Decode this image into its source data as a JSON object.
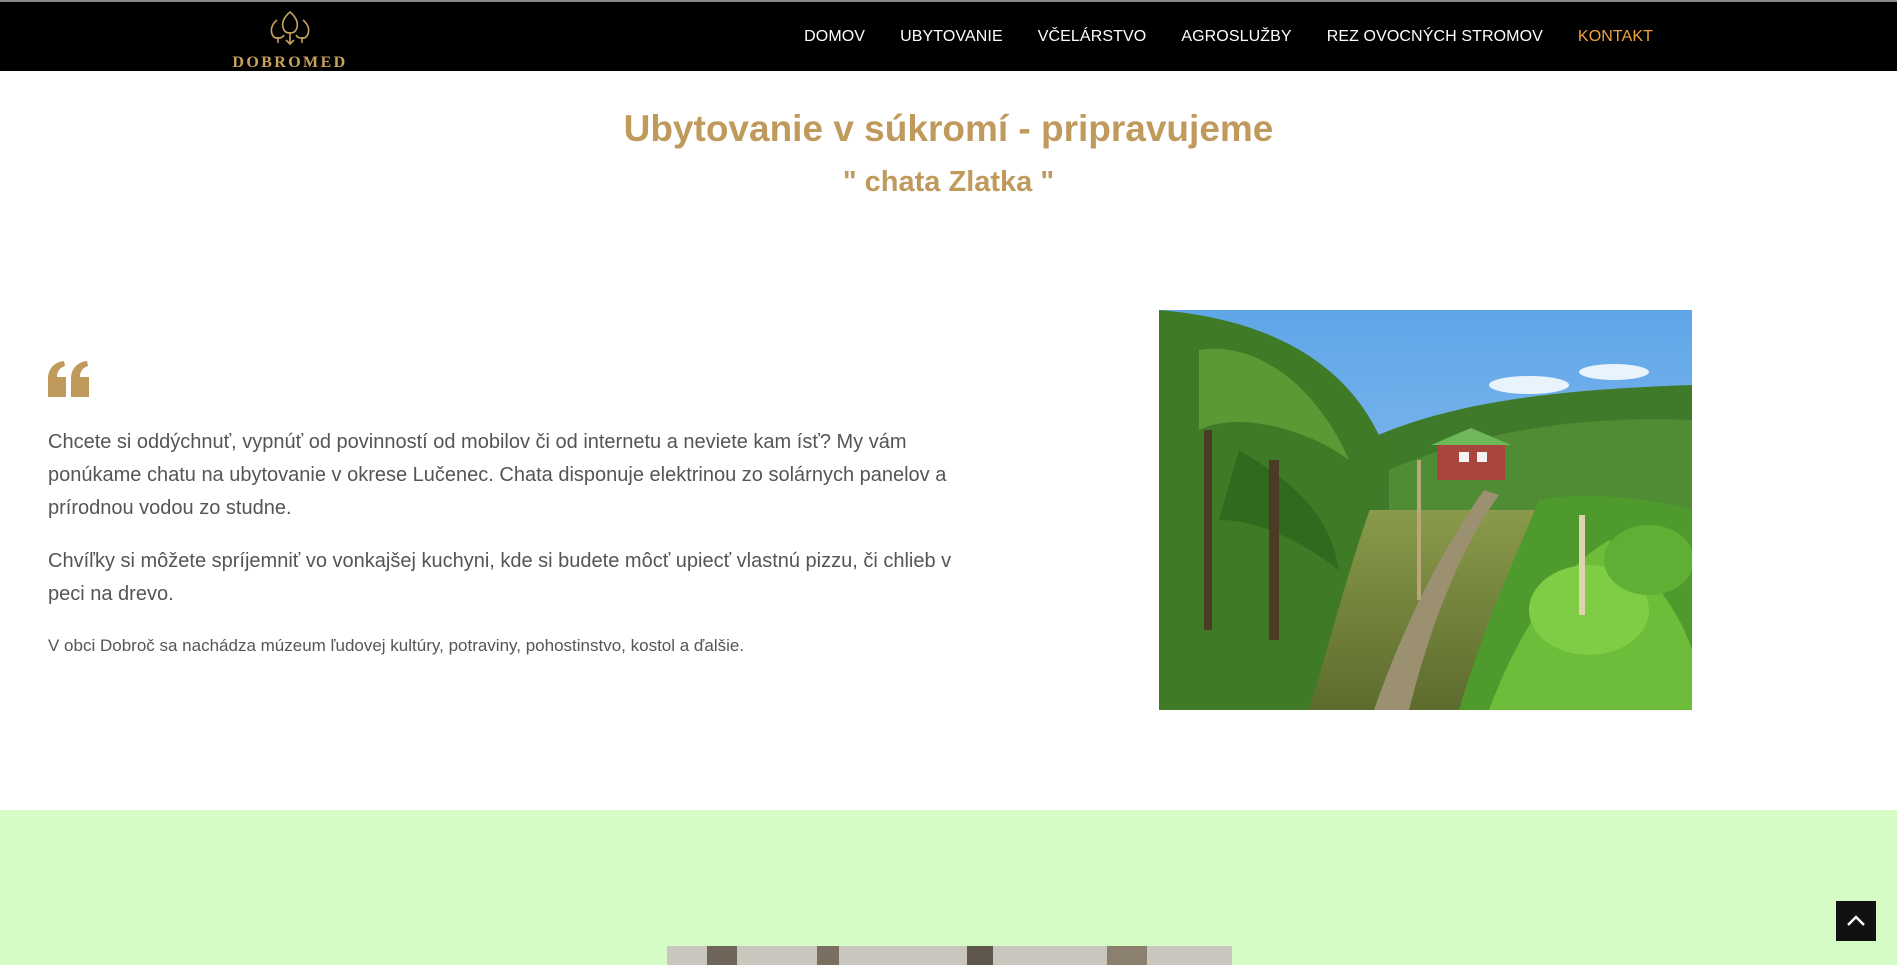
{
  "header": {
    "logo_text": "DOBROMED",
    "nav": [
      {
        "label": "DOMOV"
      },
      {
        "label": "UBYTOVANIE"
      },
      {
        "label": "VČELÁRSTVO"
      },
      {
        "label": "AGROSLUŽBY"
      },
      {
        "label": "REZ OVOCNÝCH STROMOV"
      },
      {
        "label": "KONTAKT"
      }
    ],
    "active_item": "KONTAKT"
  },
  "main": {
    "title": "Ubytovanie v súkromí - pripravujeme",
    "subtitle": "\" chata Zlatka \"",
    "paragraphs": [
      "Chcete si oddýchnuť, vypnúť od povinností od mobilov či od internetu a neviete kam ísť? My vám ponúkame chatu na ubytovanie v okrese Lučenec. Chata disponuje elektrinou zo solárnych panelov a prírodnou vodou zo studne.",
      "Chvíľky si môžete spríjemniť vo vonkajšej kuchyni, kde si budete môcť upiecť vlastnú pizzu, či chlieb v peci na drevo.",
      "V obci Dobroč sa nachádza múzeum ľudovej kultúry,  potraviny,  pohostinstvo, kostol a ďalšie."
    ]
  },
  "icons": {
    "logo": "tree-crown-logo-icon",
    "quote": "quote-icon",
    "scroll_top": "chevron-up-icon"
  },
  "colors": {
    "accent": "#c09a5c",
    "active_nav": "#f2a33a",
    "header_bg": "#000000",
    "band_bg": "#d4fcc4"
  }
}
